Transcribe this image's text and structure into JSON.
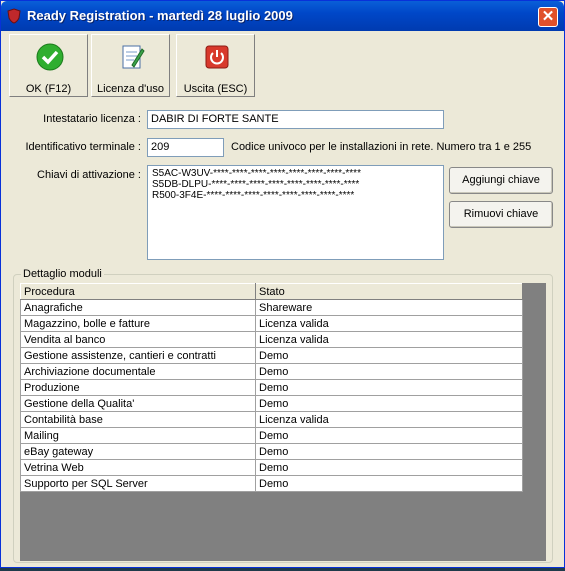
{
  "window": {
    "title": "Ready Registration - martedì 28 luglio 2009",
    "close_symbol": "✕"
  },
  "toolbar": {
    "ok_label": "OK (F12)",
    "license_label": "Licenza d'uso",
    "exit_label": "Uscita (ESC)"
  },
  "form": {
    "owner_label": "Intestatario licenza :",
    "owner_value": "DABIR DI FORTE SANTE",
    "terminal_label": "Identificativo terminale :",
    "terminal_value": "209",
    "terminal_hint": "Codice univoco per le installazioni in rete. Numero tra 1 e 255",
    "keys_label": "Chiavi di attivazione :",
    "keys": [
      "S5AC-W3UV-****-****-****-****-****-****-****-****",
      "S5DB-DLPU-****-****-****-****-****-****-****-****",
      "R500-3F4E-****-****-****-****-****-****-****-****"
    ],
    "add_key_label": "Aggiungi chiave",
    "remove_key_label": "Rimuovi chiave"
  },
  "modules": {
    "group_title": "Dettaglio moduli",
    "headers": [
      "Procedura",
      "Stato"
    ],
    "rows": [
      [
        "Anagrafiche",
        "Shareware"
      ],
      [
        "Magazzino, bolle e fatture",
        "Licenza valida"
      ],
      [
        "Vendita al banco",
        "Licenza valida"
      ],
      [
        "Gestione assistenze, cantieri e contratti",
        "Demo"
      ],
      [
        "Archiviazione documentale",
        "Demo"
      ],
      [
        "Produzione",
        "Demo"
      ],
      [
        "Gestione della Qualita'",
        "Demo"
      ],
      [
        "Contabilità base",
        "Licenza valida"
      ],
      [
        "Mailing",
        "Demo"
      ],
      [
        "eBay gateway",
        "Demo"
      ],
      [
        "Vetrina Web",
        "Demo"
      ],
      [
        "Supporto per SQL Server",
        "Demo"
      ]
    ]
  },
  "icons": {
    "app": "shield-icon",
    "ok": "check-icon",
    "license": "document-edit-icon",
    "exit": "power-icon"
  },
  "colors": {
    "titlebar": "#0047c8",
    "ok_green": "#2fae2f",
    "exit_red": "#d8392c"
  }
}
